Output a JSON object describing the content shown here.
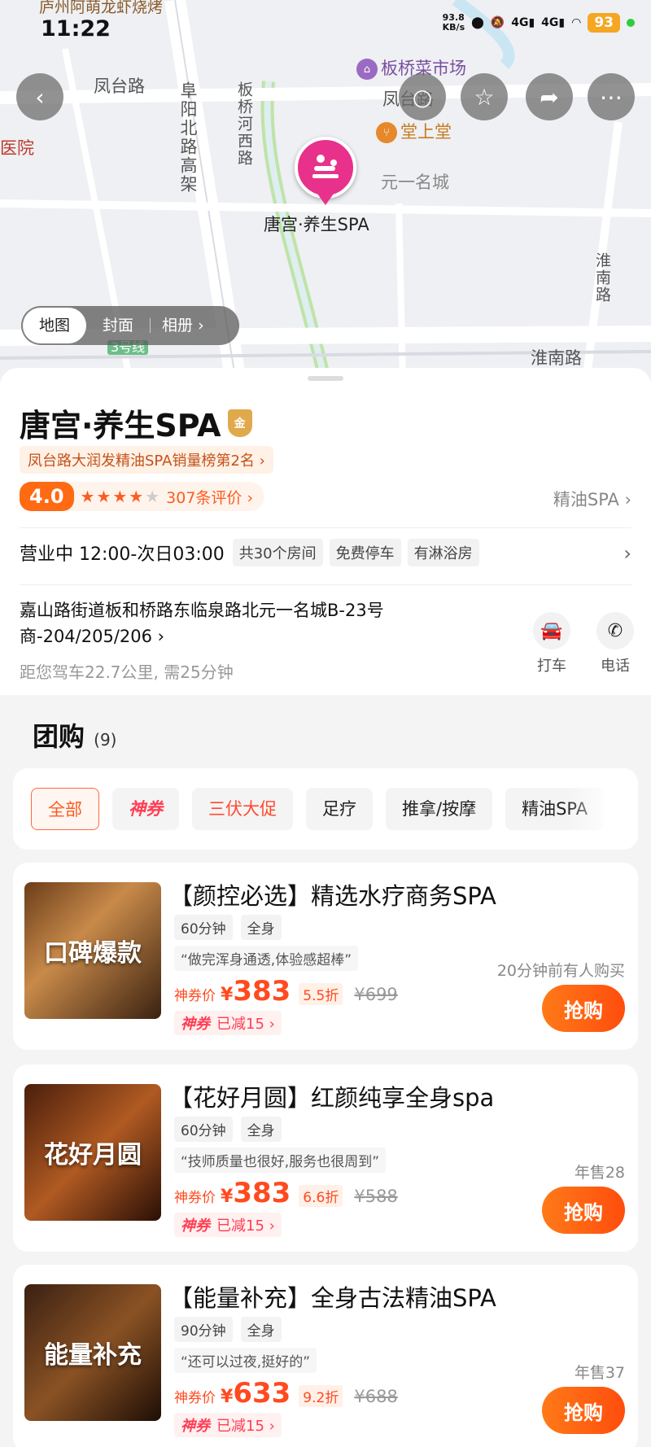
{
  "status_bar": {
    "time": "11:22",
    "speed": "93.8\nKB/s",
    "battery": "93"
  },
  "map": {
    "labels": {
      "fengtai_road_left": "凤台路",
      "fuyang_north": "阜阳北路高架",
      "banqiao_river_west": "板桥河西路",
      "banqiao_market": "板桥菜市场",
      "fengtai_road_right": "凤台路",
      "tangshangtang": "堂上堂",
      "yuanyi": "元一名城",
      "huainan_road_v": "淮南路",
      "huainan_road_h": "淮南路",
      "hospital": "医院",
      "line3": "3号线",
      "top_poi": "庐州阿萌龙虾烧烤",
      "pin_label": "唐宫·养生SPA"
    },
    "tabs": [
      "地图",
      "封面",
      "相册"
    ]
  },
  "shop": {
    "name": "唐宫·养生SPA",
    "medal": "金",
    "rank_tag": "凤台路大润发精油SPA销量榜第2名 ›",
    "score": "4.0",
    "stars": "★★★★",
    "empty_star": "★",
    "review_count": "307条评价 ›",
    "category": "精油SPA ›",
    "hours": "营业中 12:00-次日03:00",
    "tags": [
      "共30个房间",
      "免费停车",
      "有淋浴房"
    ],
    "address": "嘉山路街道板和桥路东临泉路北元一名城B-23号商-204/205/206 ›",
    "distance": "距您驾车22.7公里, 需25分钟",
    "actions": {
      "taxi": "打车",
      "phone": "电话"
    }
  },
  "group_buy": {
    "title": "团购",
    "count": "(9)",
    "filters": [
      "全部",
      "神券",
      "三伏大促",
      "足疗",
      "推拿/按摩",
      "精油SPA"
    ]
  },
  "deals": [
    {
      "image_text": "口碑爆款",
      "title": "【颜控必选】精选水疗商务SPA",
      "duration": "60分钟",
      "scope": "全身",
      "quote": "“做完浑身通透,体验感超棒”",
      "price_label": "神券价",
      "yen": "¥",
      "price": "383",
      "discount": "5.5折",
      "original": "¥699",
      "coupon_tag": "神券",
      "coupon_text": "已减15 ›",
      "sales": "20分钟前有人购买",
      "buy": "抢购"
    },
    {
      "image_text": "花好月圆",
      "title": "【花好月圆】红颜纯享全身spa",
      "duration": "60分钟",
      "scope": "全身",
      "quote": "“技师质量也很好,服务也很周到”",
      "price_label": "神券价",
      "yen": "¥",
      "price": "383",
      "discount": "6.6折",
      "original": "¥588",
      "coupon_tag": "神券",
      "coupon_text": "已减15 ›",
      "sales": "年售28",
      "buy": "抢购"
    },
    {
      "image_text": "能量补充",
      "title": "【能量补充】全身古法精油SPA",
      "duration": "90分钟",
      "scope": "全身",
      "quote": "“还可以过夜,挺好的”",
      "price_label": "神券价",
      "yen": "¥",
      "price": "633",
      "discount": "9.2折",
      "original": "¥688",
      "coupon_tag": "神券",
      "coupon_text": "已减15 ›",
      "sales": "年售37",
      "buy": "抢购"
    }
  ],
  "colors": {
    "accent": "#ff5a1f",
    "pin": "#e8318a",
    "battery": "#f5a623",
    "river": "#bfe3a8"
  }
}
